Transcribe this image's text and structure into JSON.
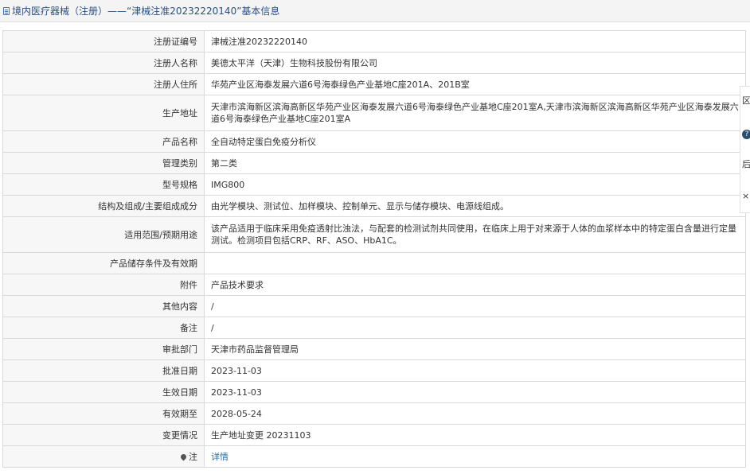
{
  "header": {
    "title": "境内医疗器械（注册）——“津械注准20232220140”基本信息"
  },
  "rows": [
    {
      "label": "注册证编号",
      "value": "津械注准20232220140"
    },
    {
      "label": "注册人名称",
      "value": "美德太平洋（天津）生物科技股份有限公司"
    },
    {
      "label": "注册人住所",
      "value": "华苑产业区海泰发展六道6号海泰绿色产业基地C座201A、201B室"
    },
    {
      "label": "生产地址",
      "value": "天津市滨海新区滨海高新区华苑产业区海泰发展六道6号海泰绿色产业基地C座201室A,天津市滨海新区滨海高新区华苑产业区海泰发展六道6号海泰绿色产业基地C座201室A"
    },
    {
      "label": "产品名称",
      "value": "全自动特定蛋白免疫分析仪"
    },
    {
      "label": "管理类别",
      "value": "第二类"
    },
    {
      "label": "型号规格",
      "value": "IMG800"
    },
    {
      "label": "结构及组成/主要组成成分",
      "value": "由光学模块、测试位、加样模块、控制单元、显示与储存模块、电源线组成。"
    },
    {
      "label": "适用范围/预期用途",
      "value": "该产品适用于临床采用免疫透射比浊法，与配套的检测试剂共同使用，在临床上用于对来源于人体的血浆样本中的特定蛋白含量进行定量测试。检测项目包括CRP、RF、ASO、HbA1C。"
    },
    {
      "label": "产品储存条件及有效期",
      "value": ""
    },
    {
      "label": "附件",
      "value": "产品技术要求"
    },
    {
      "label": "其他内容",
      "value": "/"
    },
    {
      "label": "备注",
      "value": "/"
    },
    {
      "label": "审批部门",
      "value": "天津市药品监督管理局"
    },
    {
      "label": "批准日期",
      "value": "2023-11-03"
    },
    {
      "label": "生效日期",
      "value": "2023-11-03"
    },
    {
      "label": "有效期至",
      "value": "2028-05-24"
    },
    {
      "label": "变更情况",
      "value": "生产地址变更 20231103"
    }
  ],
  "note_row": {
    "label": "注",
    "link_text": "详情"
  },
  "side_tools": {
    "t1": "区",
    "t2": "?",
    "t3": "后",
    "t4": "×"
  }
}
